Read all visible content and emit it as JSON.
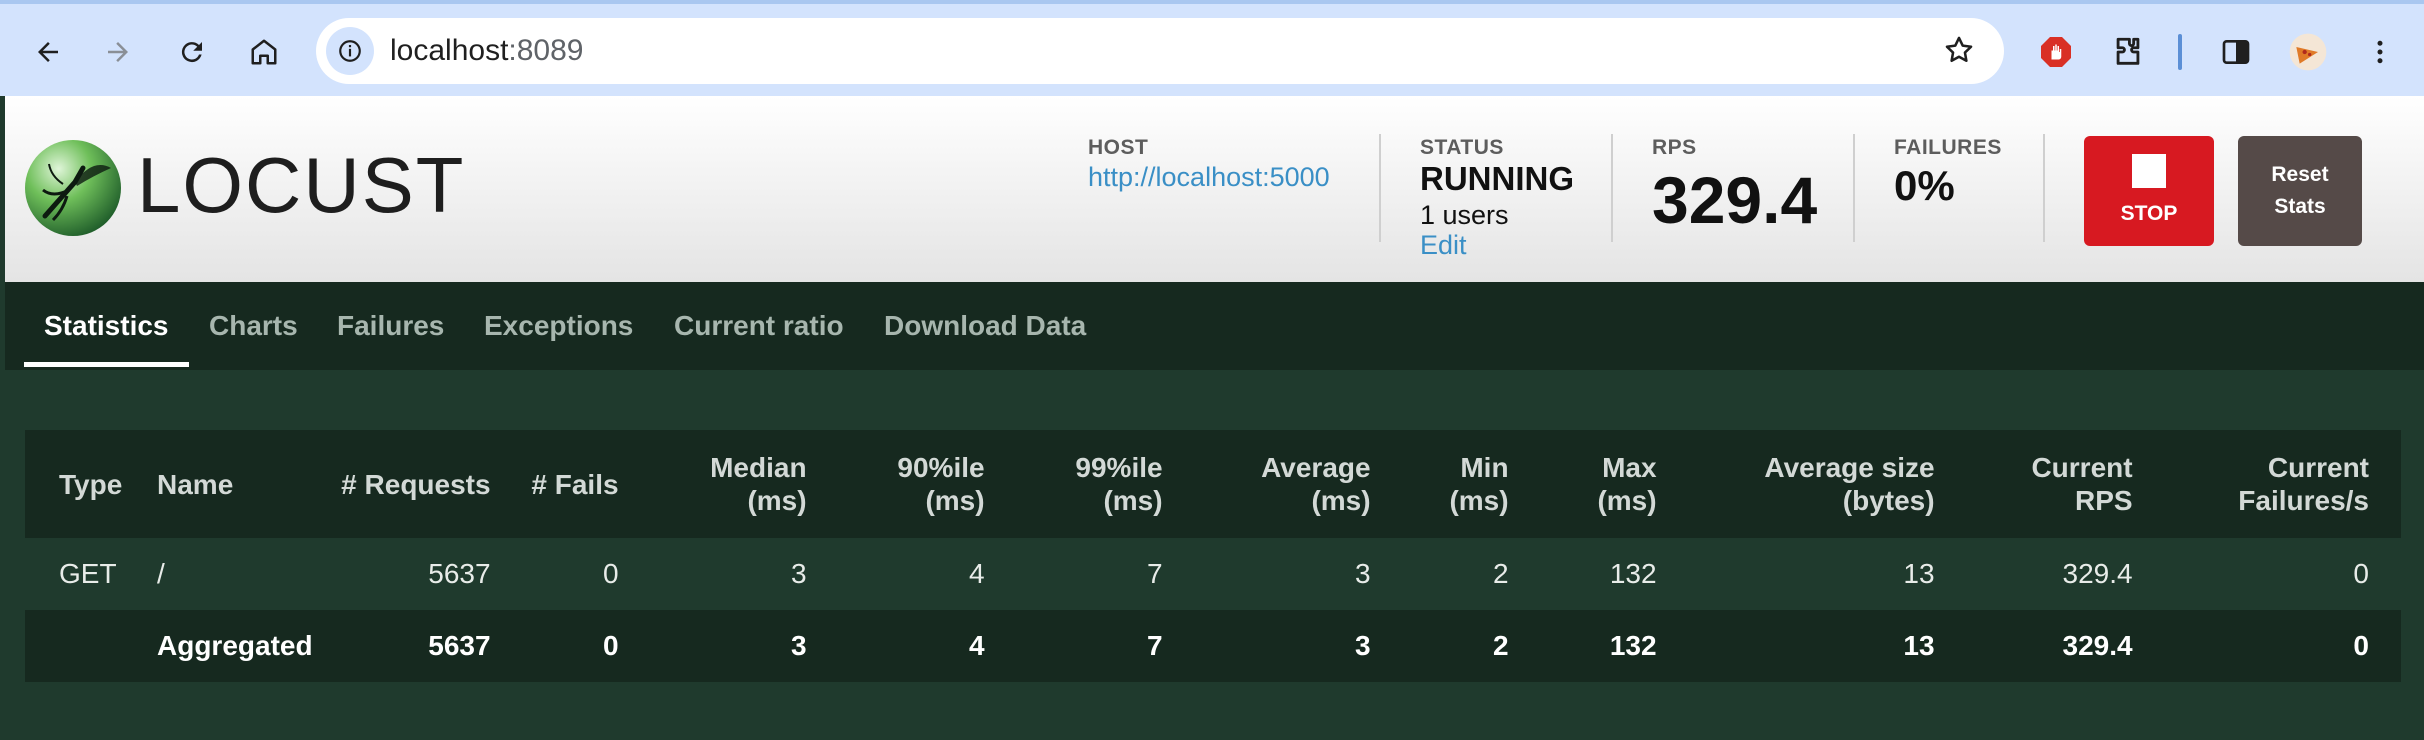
{
  "browser": {
    "url_host": "localhost",
    "url_port": ":8089"
  },
  "app": {
    "logo_text": "LOCUST",
    "host_label": "HOST",
    "host_value": "http://localhost:5000",
    "status_label": "STATUS",
    "status_value": "RUNNING",
    "users_value": "1 users",
    "edit_label": "Edit",
    "rps_label": "RPS",
    "rps_value": "329.4",
    "failures_label": "FAILURES",
    "failures_value": "0%",
    "stop_label": "STOP",
    "reset_label_line1": "Reset",
    "reset_label_line2": "Stats",
    "colors": {
      "stop": "#d71921",
      "reset": "#554a48",
      "link": "#3a8fc6",
      "panel": "#1f3a2d",
      "panel_dark": "#16291f"
    }
  },
  "tabs": [
    {
      "label": "Statistics",
      "active": true
    },
    {
      "label": "Charts"
    },
    {
      "label": "Failures"
    },
    {
      "label": "Exceptions"
    },
    {
      "label": "Current ratio"
    },
    {
      "label": "Download Data"
    }
  ],
  "table": {
    "headers": [
      [
        "Type",
        ""
      ],
      [
        "Name",
        ""
      ],
      [
        "# Requests",
        ""
      ],
      [
        "# Fails",
        ""
      ],
      [
        "Median",
        "(ms)"
      ],
      [
        "90%ile",
        "(ms)"
      ],
      [
        "99%ile",
        "(ms)"
      ],
      [
        "Average",
        "(ms)"
      ],
      [
        "Min",
        "(ms)"
      ],
      [
        "Max",
        "(ms)"
      ],
      [
        "Average size",
        "(bytes)"
      ],
      [
        "Current",
        "RPS"
      ],
      [
        "Current",
        "Failures/s"
      ]
    ],
    "rows": [
      [
        "GET",
        "/",
        "5637",
        "0",
        "3",
        "4",
        "7",
        "3",
        "2",
        "132",
        "13",
        "329.4",
        "0"
      ],
      [
        "",
        "Aggregated",
        "5637",
        "0",
        "3",
        "4",
        "7",
        "3",
        "2",
        "132",
        "13",
        "329.4",
        "0"
      ]
    ]
  }
}
